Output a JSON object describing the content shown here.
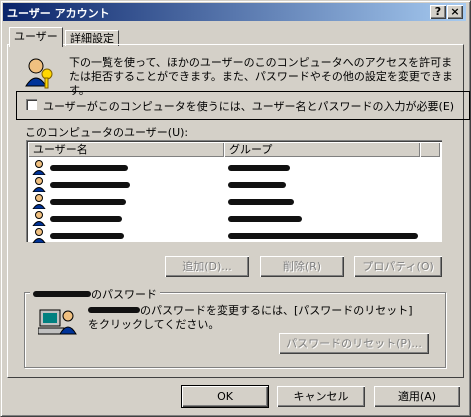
{
  "window": {
    "title": "ユーザー アカウント",
    "help_btn": "?",
    "close_btn": "×"
  },
  "tabs": [
    {
      "label": "ユーザー"
    },
    {
      "label": "詳細設定"
    }
  ],
  "description": "下の一覧を使って、ほかのユーザーのこのコンピュータへのアクセスを許可または拒否することができます。また、パスワードやその他の設定を変更できます。",
  "checkbox_label": "ユーザーがこのコンピュータを使うには、ユーザー名とパスワードの入力が必要(E)",
  "list": {
    "label": "このコンピュータのユーザー(U):",
    "columns": [
      "ユーザー名",
      "グループ"
    ],
    "rows": 5
  },
  "buttons": {
    "add": "追加(D)...",
    "delete": "削除(R)",
    "properties": "プロパティ(O)"
  },
  "password_group": {
    "label_suffix": "のパスワード",
    "text": "のパスワードを変更するには、[パスワードのリセット] をクリックしてください。",
    "reset": "パスワードのリセット(P)..."
  },
  "footer": {
    "ok": "OK",
    "cancel": "キャンセル",
    "apply": "適用(A)"
  }
}
